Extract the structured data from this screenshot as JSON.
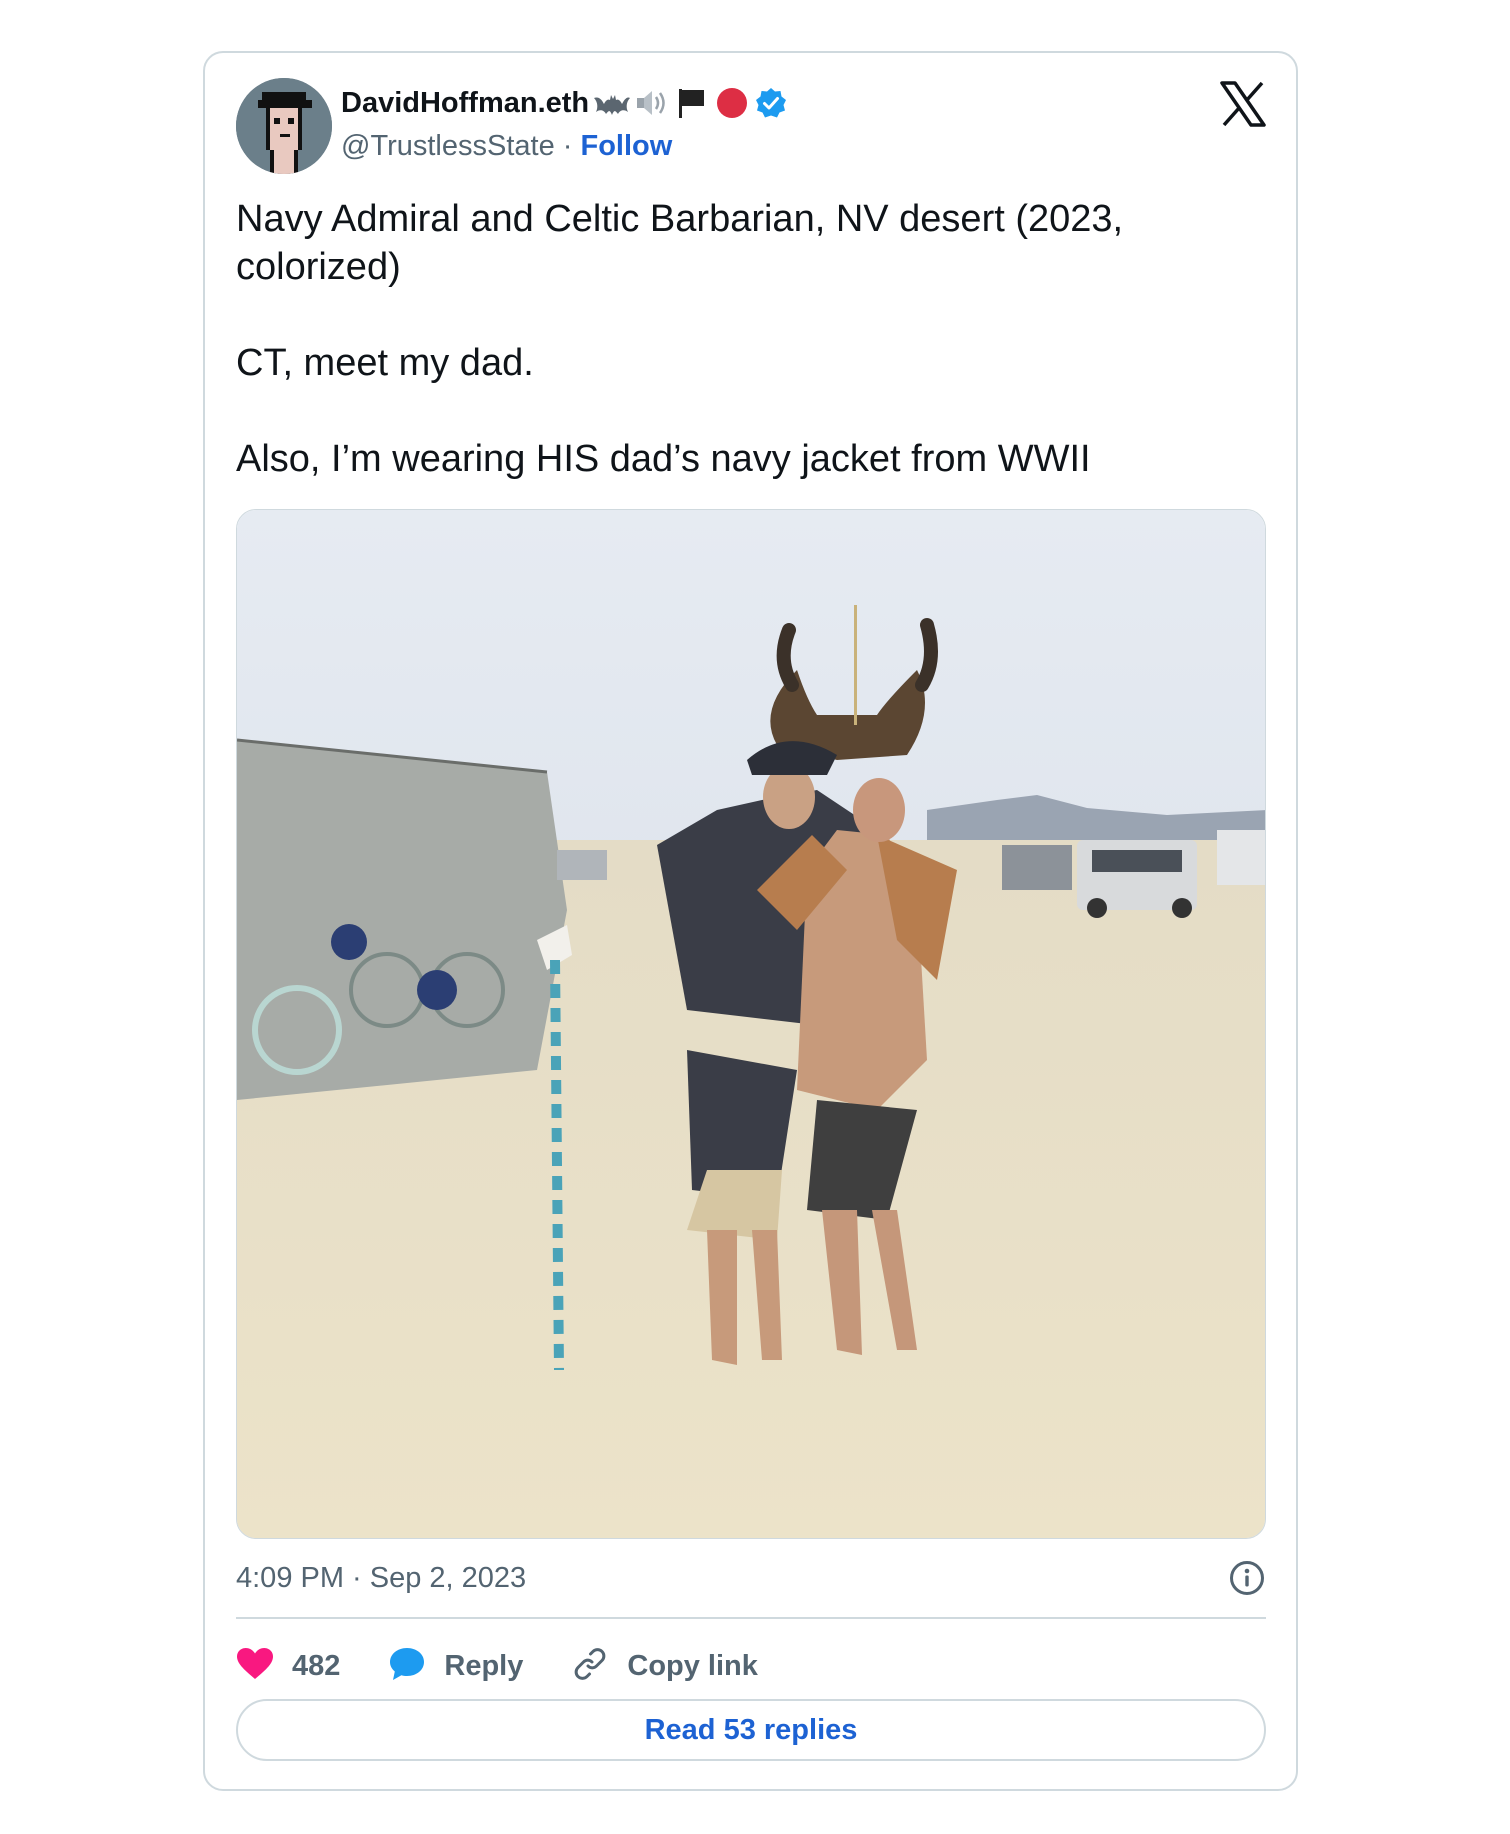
{
  "author": {
    "display_name": "DavidHoffman.eth",
    "handle": "@TrustlessState",
    "separator": " · ",
    "follow_label": "Follow",
    "verified": true,
    "name_emojis": [
      "bat-emoji",
      "speaker-emoji",
      "black-flag-emoji",
      "red-circle-emoji",
      "verified-badge"
    ]
  },
  "tweet": {
    "paragraphs": [
      "Navy Admiral and Celtic Barbarian, NV desert (2023, colorized)",
      "CT, meet my dad.",
      "Also, I’m wearing HIS dad’s navy jacket from WWII"
    ]
  },
  "timestamp": "4:09 PM · Sep 2, 2023",
  "actions": {
    "like_count": "482",
    "reply_label": "Reply",
    "copy_link_label": "Copy link"
  },
  "read_replies_label": "Read 53 replies",
  "colors": {
    "link_blue": "#1d62d3",
    "like_pink": "#f91880",
    "reply_blue": "#1d9bf0",
    "secondary_text": "#536471",
    "border": "#cfd9de"
  },
  "icons": {
    "brand": "x-logo-icon",
    "info": "info-icon",
    "like": "heart-icon",
    "reply": "speech-bubble-icon",
    "copy": "link-icon"
  }
}
